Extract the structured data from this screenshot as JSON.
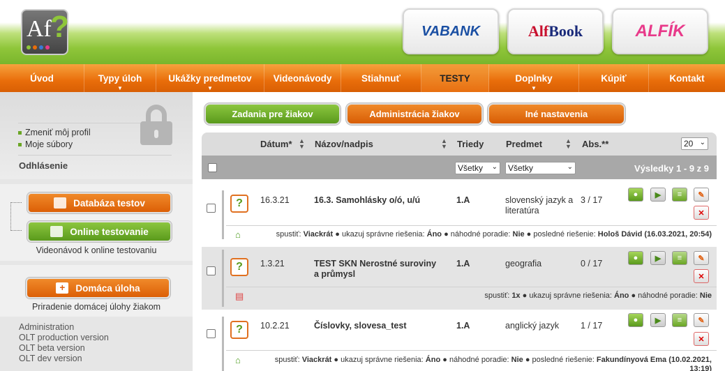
{
  "logo": {
    "text": "Af",
    "mark": "?"
  },
  "brands": [
    {
      "name": "VABANK"
    },
    {
      "name_a": "Alf",
      "name_b": "Book"
    },
    {
      "name": "ALFÍK"
    }
  ],
  "nav": [
    {
      "label": "Úvod",
      "dropdown": false
    },
    {
      "label": "Typy úloh",
      "dropdown": true
    },
    {
      "label": "Ukážky predmetov",
      "dropdown": true
    },
    {
      "label": "Videonávody",
      "dropdown": false
    },
    {
      "label": "Stiahnuť",
      "dropdown": false
    },
    {
      "label": "TESTY",
      "dropdown": false,
      "active": true
    },
    {
      "label": "Doplnky",
      "dropdown": true
    },
    {
      "label": "Kúpiť",
      "dropdown": false
    },
    {
      "label": "Kontakt",
      "dropdown": false
    }
  ],
  "sidebar": {
    "profile_link": "Zmeniť môj profil",
    "files_link": "Moje súbory",
    "logout": "Odhlásenie",
    "db_button": "Databáza testov",
    "online_button": "Online testovanie",
    "online_caption": "Videonávod k online testovaniu",
    "homework_button": "Domáca úloha",
    "homework_caption": "Priradenie domácej úlohy žiakom",
    "admin_links": [
      "Administration",
      "OLT production version",
      "OLT beta version",
      "OLT dev version"
    ]
  },
  "tabs": {
    "assignments": "Zadania pre žiakov",
    "admin": "Administrácia žiakov",
    "settings": "Iné nastavenia"
  },
  "table": {
    "headers": {
      "date": "Dátum*",
      "title": "Názov/nadpis",
      "classes": "Triedy",
      "subject": "Predmet",
      "abs": "Abs.**"
    },
    "per_page": "20",
    "filter_classes": "Všetky",
    "filter_subject": "Všetky",
    "results_label": "Výsledky",
    "results_range": "1 - 9 z 9",
    "rows": [
      {
        "date": "16.3.21",
        "title": "16.3. Samohlásky o/ó, u/ú",
        "classes": "1.A",
        "subject": "slovenský jazyk a literatúra",
        "abs": "3 / 17",
        "info_pre": "spustiť:",
        "run": "Viackrát",
        "show_label": "ukazuj správne riešenia:",
        "show": "Áno",
        "random_label": "náhodné poradie:",
        "random": "Nie",
        "last_label": "posledné riešenie:",
        "last": "Hološ Dávid (16.03.2021, 20:54)"
      },
      {
        "date": "1.3.21",
        "title": "TEST SKN Nerostné suroviny a průmysl",
        "classes": "1.A",
        "subject": "geografia",
        "abs": "0 / 17",
        "info_pre": "spustiť:",
        "run": "1x",
        "show_label": "ukazuj správne riešenia:",
        "show": "Áno",
        "random_label": "náhodné poradie:",
        "random": "Nie"
      },
      {
        "date": "10.2.21",
        "title": "Číslovky, slovesa_test",
        "classes": "1.A",
        "subject": "anglický jazyk",
        "abs": "1 / 17",
        "info_pre": "spustiť:",
        "run": "Viackrát",
        "show_label": "ukazuj správne riešenia:",
        "show": "Áno",
        "random_label": "náhodné poradie:",
        "random": "Nie",
        "last_label": "posledné riešenie:",
        "last": "Fakundínyová Ema (10.02.2021,",
        "last2": "13:19)"
      }
    ]
  },
  "colors": {
    "orange": "#e96d0a",
    "green": "#6aa624",
    "header_green": "#8fc63a"
  }
}
